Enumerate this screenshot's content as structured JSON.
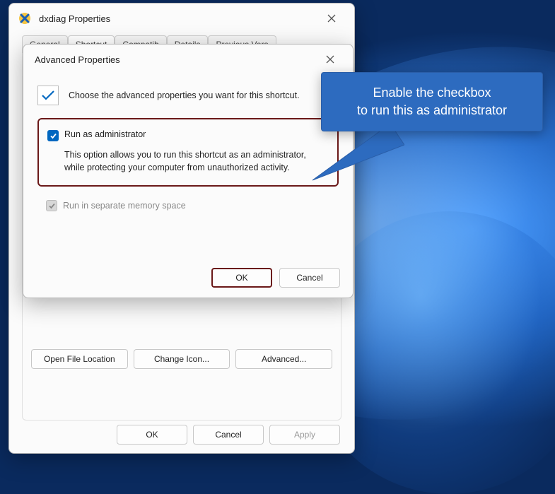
{
  "parent": {
    "title": "dxdiag Properties",
    "tabs": [
      "General",
      "Shortcut",
      "Compatib",
      "Details",
      "Previous Vers"
    ],
    "active_tab_index": 1,
    "buttons": {
      "open_file_location": "Open File Location",
      "change_icon": "Change Icon...",
      "advanced": "Advanced..."
    },
    "footer": {
      "ok": "OK",
      "cancel": "Cancel",
      "apply": "Apply"
    }
  },
  "child": {
    "title": "Advanced Properties",
    "hint": "Choose the advanced properties you want for this shortcut.",
    "run_as_admin": {
      "label": "Run as administrator",
      "checked": true,
      "description": "This option allows you to run this shortcut as an administrator, while protecting your computer from unauthorized activity."
    },
    "separate_memory": {
      "label": "Run in separate memory space",
      "checked": true,
      "enabled": false
    },
    "footer": {
      "ok": "OK",
      "cancel": "Cancel"
    }
  },
  "callout": {
    "line1": "Enable the checkbox",
    "line2": "to run this as administrator"
  }
}
